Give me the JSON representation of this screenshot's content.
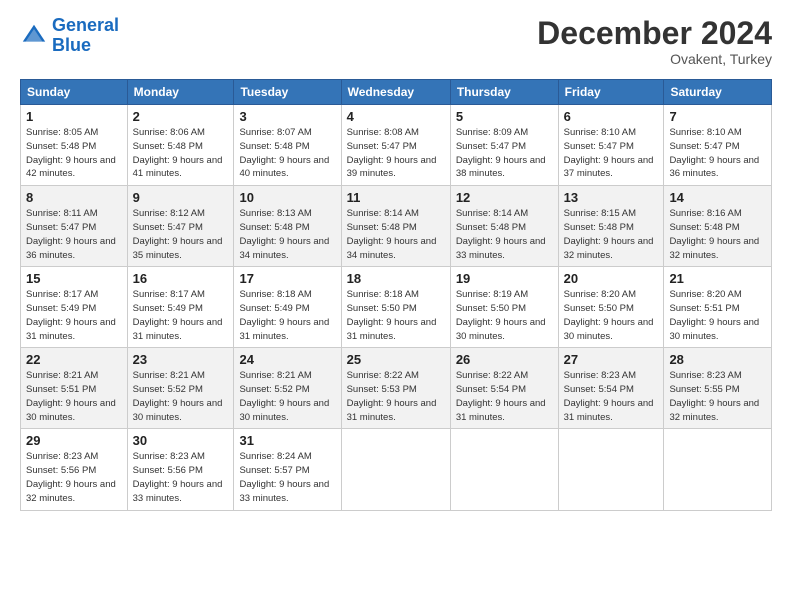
{
  "header": {
    "logo_general": "General",
    "logo_blue": "Blue",
    "title": "December 2024",
    "subtitle": "Ovakent, Turkey"
  },
  "columns": [
    "Sunday",
    "Monday",
    "Tuesday",
    "Wednesday",
    "Thursday",
    "Friday",
    "Saturday"
  ],
  "weeks": [
    [
      {
        "day": "1",
        "sunrise": "8:05 AM",
        "sunset": "5:48 PM",
        "daylight": "9 hours and 42 minutes."
      },
      {
        "day": "2",
        "sunrise": "8:06 AM",
        "sunset": "5:48 PM",
        "daylight": "9 hours and 41 minutes."
      },
      {
        "day": "3",
        "sunrise": "8:07 AM",
        "sunset": "5:48 PM",
        "daylight": "9 hours and 40 minutes."
      },
      {
        "day": "4",
        "sunrise": "8:08 AM",
        "sunset": "5:47 PM",
        "daylight": "9 hours and 39 minutes."
      },
      {
        "day": "5",
        "sunrise": "8:09 AM",
        "sunset": "5:47 PM",
        "daylight": "9 hours and 38 minutes."
      },
      {
        "day": "6",
        "sunrise": "8:10 AM",
        "sunset": "5:47 PM",
        "daylight": "9 hours and 37 minutes."
      },
      {
        "day": "7",
        "sunrise": "8:10 AM",
        "sunset": "5:47 PM",
        "daylight": "9 hours and 36 minutes."
      }
    ],
    [
      {
        "day": "8",
        "sunrise": "8:11 AM",
        "sunset": "5:47 PM",
        "daylight": "9 hours and 36 minutes."
      },
      {
        "day": "9",
        "sunrise": "8:12 AM",
        "sunset": "5:47 PM",
        "daylight": "9 hours and 35 minutes."
      },
      {
        "day": "10",
        "sunrise": "8:13 AM",
        "sunset": "5:48 PM",
        "daylight": "9 hours and 34 minutes."
      },
      {
        "day": "11",
        "sunrise": "8:14 AM",
        "sunset": "5:48 PM",
        "daylight": "9 hours and 34 minutes."
      },
      {
        "day": "12",
        "sunrise": "8:14 AM",
        "sunset": "5:48 PM",
        "daylight": "9 hours and 33 minutes."
      },
      {
        "day": "13",
        "sunrise": "8:15 AM",
        "sunset": "5:48 PM",
        "daylight": "9 hours and 32 minutes."
      },
      {
        "day": "14",
        "sunrise": "8:16 AM",
        "sunset": "5:48 PM",
        "daylight": "9 hours and 32 minutes."
      }
    ],
    [
      {
        "day": "15",
        "sunrise": "8:17 AM",
        "sunset": "5:49 PM",
        "daylight": "9 hours and 31 minutes."
      },
      {
        "day": "16",
        "sunrise": "8:17 AM",
        "sunset": "5:49 PM",
        "daylight": "9 hours and 31 minutes."
      },
      {
        "day": "17",
        "sunrise": "8:18 AM",
        "sunset": "5:49 PM",
        "daylight": "9 hours and 31 minutes."
      },
      {
        "day": "18",
        "sunrise": "8:18 AM",
        "sunset": "5:50 PM",
        "daylight": "9 hours and 31 minutes."
      },
      {
        "day": "19",
        "sunrise": "8:19 AM",
        "sunset": "5:50 PM",
        "daylight": "9 hours and 30 minutes."
      },
      {
        "day": "20",
        "sunrise": "8:20 AM",
        "sunset": "5:50 PM",
        "daylight": "9 hours and 30 minutes."
      },
      {
        "day": "21",
        "sunrise": "8:20 AM",
        "sunset": "5:51 PM",
        "daylight": "9 hours and 30 minutes."
      }
    ],
    [
      {
        "day": "22",
        "sunrise": "8:21 AM",
        "sunset": "5:51 PM",
        "daylight": "9 hours and 30 minutes."
      },
      {
        "day": "23",
        "sunrise": "8:21 AM",
        "sunset": "5:52 PM",
        "daylight": "9 hours and 30 minutes."
      },
      {
        "day": "24",
        "sunrise": "8:21 AM",
        "sunset": "5:52 PM",
        "daylight": "9 hours and 30 minutes."
      },
      {
        "day": "25",
        "sunrise": "8:22 AM",
        "sunset": "5:53 PM",
        "daylight": "9 hours and 31 minutes."
      },
      {
        "day": "26",
        "sunrise": "8:22 AM",
        "sunset": "5:54 PM",
        "daylight": "9 hours and 31 minutes."
      },
      {
        "day": "27",
        "sunrise": "8:23 AM",
        "sunset": "5:54 PM",
        "daylight": "9 hours and 31 minutes."
      },
      {
        "day": "28",
        "sunrise": "8:23 AM",
        "sunset": "5:55 PM",
        "daylight": "9 hours and 32 minutes."
      }
    ],
    [
      {
        "day": "29",
        "sunrise": "8:23 AM",
        "sunset": "5:56 PM",
        "daylight": "9 hours and 32 minutes."
      },
      {
        "day": "30",
        "sunrise": "8:23 AM",
        "sunset": "5:56 PM",
        "daylight": "9 hours and 33 minutes."
      },
      {
        "day": "31",
        "sunrise": "8:24 AM",
        "sunset": "5:57 PM",
        "daylight": "9 hours and 33 minutes."
      },
      null,
      null,
      null,
      null
    ]
  ]
}
